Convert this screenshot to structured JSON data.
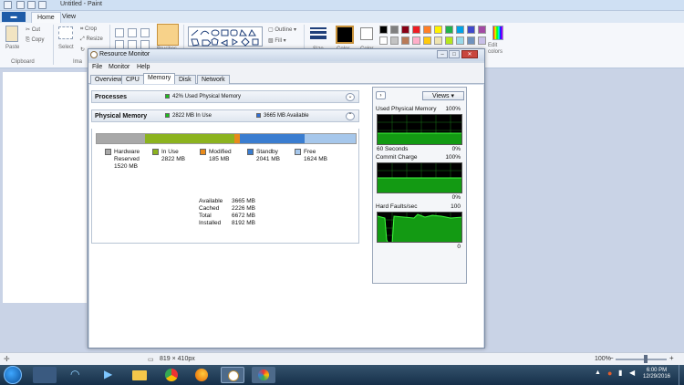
{
  "paint": {
    "title": "Untitled - Paint",
    "file_menu": "▬",
    "tabs": [
      "Home",
      "View"
    ],
    "ribbon": {
      "paste": "Paste",
      "cut": "Cut",
      "copy": "Copy",
      "select": "Select",
      "crop": "Crop",
      "resize": "Resize",
      "rotate": "",
      "brushes": "Brushes",
      "outline": "Outline",
      "fill": "Fill",
      "size": "Size",
      "color1": "Color",
      "color2": "Color",
      "edit_colors": "Edit colors",
      "group_clipboard": "Clipboard",
      "group_image": "Ima"
    },
    "palette": [
      "#000000",
      "#7f7f7f",
      "#880015",
      "#ed1c24",
      "#ff7f27",
      "#fff200",
      "#22b14c",
      "#00a2e8",
      "#3f48cc",
      "#a349a4",
      "#ffffff",
      "#c3c3c3",
      "#b97a57",
      "#ffaec9",
      "#ffc90e",
      "#efe4b0",
      "#b5e61d",
      "#99d9ea",
      "#7092be",
      "#c8bfe7"
    ],
    "status": {
      "canvas_size": "819 × 410px",
      "zoom": "100%"
    }
  },
  "resource_monitor": {
    "title": "Resource Monitor",
    "window_buttons": {
      "minimize": "–",
      "maximize": "□",
      "close": "✕"
    },
    "menu": [
      "File",
      "Monitor",
      "Help"
    ],
    "tabs": [
      "Overview",
      "CPU",
      "Memory",
      "Disk",
      "Network"
    ],
    "active_tab": "Memory",
    "processes_header": {
      "title": "Processes",
      "stat": "42% Used Physical Memory",
      "stat_color": "#1bbf1b"
    },
    "physical_memory_header": {
      "title": "Physical Memory",
      "in_use": "2822 MB In Use",
      "available": "3665 MB Available",
      "in_use_color": "#1bbf1b",
      "available_color": "#2f6fd8"
    },
    "bar_segments": [
      {
        "name": "Hardware Reserved",
        "mb": 1520,
        "color": "#a8a8a8"
      },
      {
        "name": "In Use",
        "mb": 2822,
        "color": "#8cb31e"
      },
      {
        "name": "Modified",
        "mb": 185,
        "color": "#e88a1a"
      },
      {
        "name": "Standby",
        "mb": 2041,
        "color": "#3a7dd0"
      },
      {
        "name": "Free",
        "mb": 1624,
        "color": "#a6c7eb"
      }
    ],
    "legend": [
      {
        "label": "Hardware",
        "label2": "Reserved",
        "value": "1520 MB",
        "color": "#a8a8a8"
      },
      {
        "label": "In Use",
        "value": "2822 MB",
        "color": "#8cb31e"
      },
      {
        "label": "Modified",
        "value": "185 MB",
        "color": "#e88a1a"
      },
      {
        "label": "Standby",
        "value": "2041 MB",
        "color": "#3a7dd0"
      },
      {
        "label": "Free",
        "value": "1624 MB",
        "color": "#a6c7eb"
      }
    ],
    "summary": [
      {
        "label": "Available",
        "value": "3665 MB"
      },
      {
        "label": "Cached",
        "value": "2226 MB"
      },
      {
        "label": "Total",
        "value": "6672 MB"
      },
      {
        "label": "Installed",
        "value": "8192 MB"
      }
    ],
    "graphs": {
      "views_button": "Views",
      "expand_icon": "›",
      "used_physical": {
        "title": "Used Physical Memory",
        "max": "100%",
        "min": "0%",
        "left": "60 Seconds"
      },
      "commit_charge": {
        "title": "Commit Charge",
        "max": "100%",
        "min": "0%"
      },
      "hard_faults": {
        "title": "Hard Faults/sec",
        "max": "100",
        "min": "0"
      }
    }
  },
  "taskbar": {
    "time": "6:00 PM",
    "date": "12/29/2016"
  }
}
